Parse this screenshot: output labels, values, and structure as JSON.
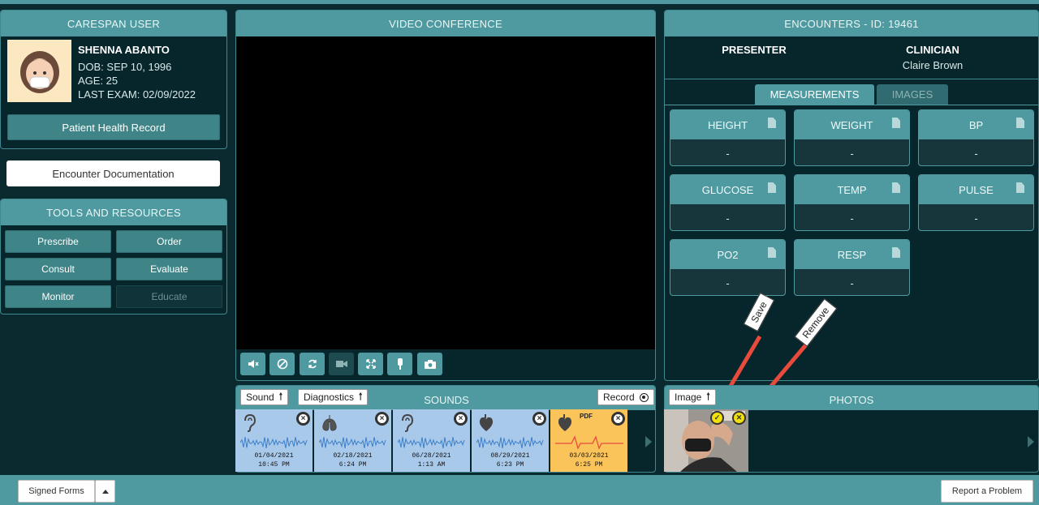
{
  "left": {
    "user_header": "CARESPAN USER",
    "patient": {
      "name": "SHENNA ABANTO",
      "dob": "DOB: SEP 10, 1996",
      "age": "AGE: 25",
      "last_exam": "LAST EXAM: 02/09/2022"
    },
    "phr_button": "Patient Health Record",
    "encounter_doc_button": "Encounter Documentation",
    "tools_header": "TOOLS AND RESOURCES",
    "tools": [
      "Prescribe",
      "Order",
      "Consult",
      "Evaluate",
      "Monitor",
      "Educate"
    ]
  },
  "video": {
    "header": "VIDEO CONFERENCE",
    "controls": [
      "mute-icon",
      "audio-off-icon",
      "refresh-icon",
      "camera-icon",
      "fullscreen-icon",
      "light-icon",
      "snapshot-icon"
    ]
  },
  "sounds": {
    "sound_btn": "Sound",
    "diagnostics_btn": "Diagnostics",
    "title": "SOUNDS",
    "record_btn": "Record",
    "items": [
      {
        "icon": "ear-icon",
        "date": "01/04/2021",
        "time": "10:45 PM",
        "color": "#a9c9ea"
      },
      {
        "icon": "lungs-icon",
        "date": "02/18/2021",
        "time": "6:24 PM",
        "color": "#a9c9ea"
      },
      {
        "icon": "ear-icon",
        "date": "06/28/2021",
        "time": "1:13 AM",
        "color": "#a9c9ea"
      },
      {
        "icon": "heart-icon",
        "date": "08/29/2021",
        "time": "6:23 PM",
        "color": "#a9c9ea"
      },
      {
        "icon": "heart-icon",
        "date": "03/03/2021",
        "time": "6:25 PM",
        "color": "#fbc45a",
        "badge": "PDF"
      }
    ]
  },
  "encounter": {
    "header": "ENCOUNTERS - ID: 19461",
    "presenter_label": "PRESENTER",
    "clinician_label": "CLINICIAN",
    "clinician_name": "Claire Brown",
    "tabs": [
      "MEASUREMENTS",
      "IMAGES"
    ],
    "measurements": [
      {
        "label": "HEIGHT",
        "value": "-"
      },
      {
        "label": "WEIGHT",
        "value": "-"
      },
      {
        "label": "BP",
        "value": "-"
      },
      {
        "label": "GLUCOSE",
        "value": "-"
      },
      {
        "label": "TEMP",
        "value": "-"
      },
      {
        "label": "PULSE",
        "value": "-"
      },
      {
        "label": "PO2",
        "value": "-"
      },
      {
        "label": "RESP",
        "value": "-"
      }
    ]
  },
  "photos": {
    "image_btn": "Image",
    "title": "PHOTOS",
    "annotations": {
      "save": "Save",
      "remove": "Remove"
    }
  },
  "footer": {
    "signed_forms": "Signed Forms",
    "report": "Report a Problem"
  },
  "colors": {
    "teal": "#4e9aa0",
    "dark": "#07262c",
    "arrow": "#e84a3c",
    "orange": "#fbc45a",
    "blue": "#a9c9ea"
  }
}
